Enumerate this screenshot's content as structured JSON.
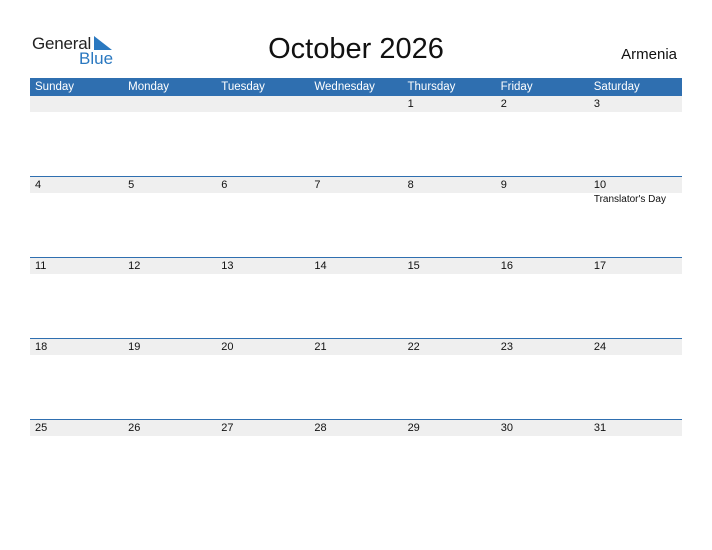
{
  "logo": {
    "general": "General",
    "blue": "Blue",
    "icon": "triangle-flag-icon"
  },
  "title": "October 2026",
  "country": "Armenia",
  "colors": {
    "accent": "#2f6fb0",
    "logo_blue": "#2a78c0",
    "date_strip": "#efefef"
  },
  "days_of_week": [
    "Sunday",
    "Monday",
    "Tuesday",
    "Wednesday",
    "Thursday",
    "Friday",
    "Saturday"
  ],
  "weeks": [
    {
      "days": [
        {
          "num": "",
          "holiday": ""
        },
        {
          "num": "",
          "holiday": ""
        },
        {
          "num": "",
          "holiday": ""
        },
        {
          "num": "",
          "holiday": ""
        },
        {
          "num": "1",
          "holiday": ""
        },
        {
          "num": "2",
          "holiday": ""
        },
        {
          "num": "3",
          "holiday": ""
        }
      ]
    },
    {
      "days": [
        {
          "num": "4",
          "holiday": ""
        },
        {
          "num": "5",
          "holiday": ""
        },
        {
          "num": "6",
          "holiday": ""
        },
        {
          "num": "7",
          "holiday": ""
        },
        {
          "num": "8",
          "holiday": ""
        },
        {
          "num": "9",
          "holiday": ""
        },
        {
          "num": "10",
          "holiday": "Translator's Day"
        }
      ]
    },
    {
      "days": [
        {
          "num": "11",
          "holiday": ""
        },
        {
          "num": "12",
          "holiday": ""
        },
        {
          "num": "13",
          "holiday": ""
        },
        {
          "num": "14",
          "holiday": ""
        },
        {
          "num": "15",
          "holiday": ""
        },
        {
          "num": "16",
          "holiday": ""
        },
        {
          "num": "17",
          "holiday": ""
        }
      ]
    },
    {
      "days": [
        {
          "num": "18",
          "holiday": ""
        },
        {
          "num": "19",
          "holiday": ""
        },
        {
          "num": "20",
          "holiday": ""
        },
        {
          "num": "21",
          "holiday": ""
        },
        {
          "num": "22",
          "holiday": ""
        },
        {
          "num": "23",
          "holiday": ""
        },
        {
          "num": "24",
          "holiday": ""
        }
      ]
    },
    {
      "days": [
        {
          "num": "25",
          "holiday": ""
        },
        {
          "num": "26",
          "holiday": ""
        },
        {
          "num": "27",
          "holiday": ""
        },
        {
          "num": "28",
          "holiday": ""
        },
        {
          "num": "29",
          "holiday": ""
        },
        {
          "num": "30",
          "holiday": ""
        },
        {
          "num": "31",
          "holiday": ""
        }
      ]
    }
  ]
}
